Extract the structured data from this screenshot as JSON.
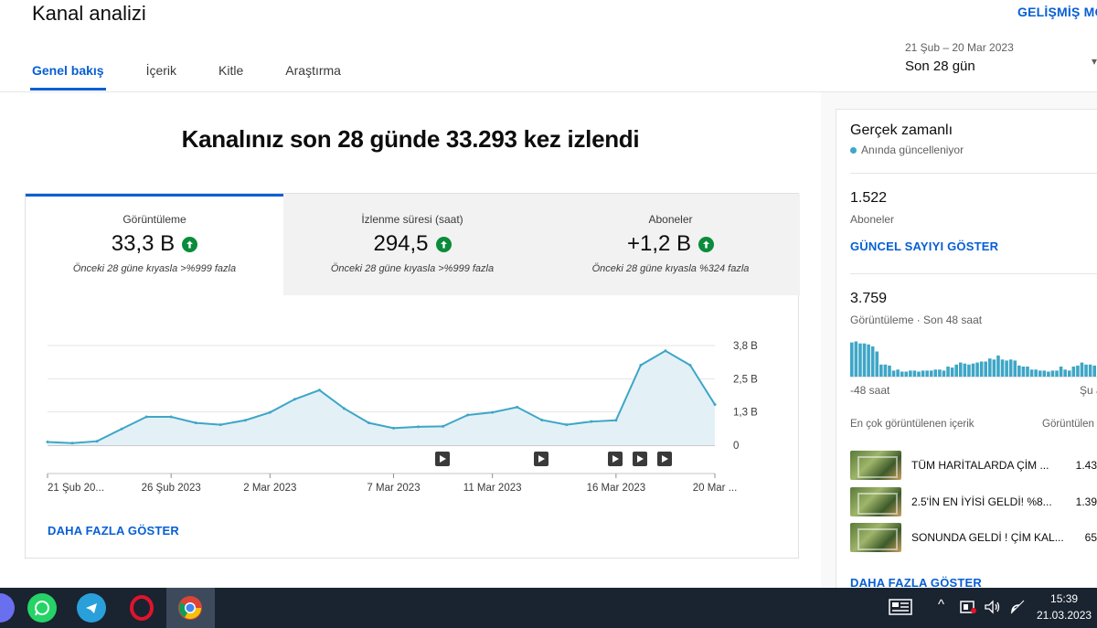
{
  "header": {
    "title": "Kanal analizi",
    "advanced_mode": "GELİŞMİŞ MO",
    "tabs": [
      {
        "label": "Genel bakış"
      },
      {
        "label": "İçerik"
      },
      {
        "label": "Kitle"
      },
      {
        "label": "Araştırma"
      }
    ],
    "active_tab": "Genel bakış",
    "date_range": "21 Şub – 20 Mar 2023",
    "date_period": "Son 28 gün"
  },
  "main": {
    "headline": "Kanalınız son 28 günde 33.293 kez izlendi",
    "metrics": [
      {
        "label": "Görüntüleme",
        "value": "33,3 B",
        "compare": "Önceki 28 güne kıyasla >%999 fazla"
      },
      {
        "label": "İzlenme süresi (saat)",
        "value": "294,5",
        "compare": "Önceki 28 güne kıyasla >%999 fazla"
      },
      {
        "label": "Aboneler",
        "value": "+1,2 B",
        "compare": "Önceki 28 güne kıyasla %324 fazla"
      }
    ],
    "more_label": "DAHA FAZLA GÖSTER"
  },
  "chart_data": {
    "type": "area",
    "title": "",
    "x": [
      "21 Şub",
      "22 Şub",
      "23 Şub",
      "24 Şub",
      "25 Şub",
      "26 Şub",
      "27 Şub",
      "28 Şub",
      "1 Mar",
      "2 Mar",
      "3 Mar",
      "4 Mar",
      "5 Mar",
      "6 Mar",
      "7 Mar",
      "8 Mar",
      "9 Mar",
      "10 Mar",
      "11 Mar",
      "12 Mar",
      "13 Mar",
      "14 Mar",
      "15 Mar",
      "16 Mar",
      "17 Mar",
      "18 Mar",
      "19 Mar",
      "20 Mar"
    ],
    "x_tick_labels": [
      "21 Şub 20...",
      "26 Şub 2023",
      "2 Mar 2023",
      "7 Mar 2023",
      "11 Mar 2023",
      "16 Mar 2023",
      "20 Mar ..."
    ],
    "y_tick_labels": [
      "3,8 B",
      "2,5 B",
      "1,3 B",
      "0"
    ],
    "ylim": [
      0,
      3800
    ],
    "grid": true,
    "series": [
      {
        "values": [
          120,
          80,
          150,
          620,
          1080,
          1080,
          850,
          780,
          950,
          1250,
          1750,
          2100,
          1400,
          850,
          650,
          700,
          720,
          1150,
          1250,
          1450,
          960,
          780,
          900,
          950,
          3050,
          3600,
          3050,
          1550
        ]
      }
    ],
    "event_markers": [
      "16 Mar",
      "16 Mar",
      "18 Mar",
      "19 Mar",
      "20 Mar"
    ]
  },
  "realtime": {
    "title": "Gerçek zamanlı",
    "live_label": "Anında güncelleniyor",
    "subscribers_value": "1.522",
    "subscribers_label": "Aboneler",
    "show_count_label": "GÜNCEL SAYIYI GÖSTER",
    "views_value": "3.759",
    "views_label": "Görüntüleme · Son 48 saat",
    "axis_left": "-48 saat",
    "axis_right": "Şu a",
    "top_content_header": "En çok görüntülenen içerik",
    "top_content_col": "Görüntülen",
    "top_content": [
      {
        "title": "TÜM HARİTALARDA ÇİM ...",
        "value": "1.43"
      },
      {
        "title": "2.5'İN EN İYİSİ GELDİ! %8...",
        "value": "1.39"
      },
      {
        "title": "SONUNDA GELDİ ! ÇİM KAL...",
        "value": "65"
      }
    ],
    "more_label": "DAHA FAZLA GÖSTER",
    "hourly_bars": [
      34,
      35,
      33,
      33,
      32,
      30,
      25,
      12,
      12,
      11,
      6,
      7,
      5,
      5,
      6,
      6,
      5,
      6,
      6,
      6,
      7,
      7,
      6,
      10,
      9,
      12,
      14,
      13,
      12,
      13,
      14,
      15,
      15,
      18,
      17,
      21,
      17,
      16,
      17,
      16,
      11,
      10,
      10,
      7,
      7,
      6,
      6,
      5,
      6,
      6,
      10,
      7,
      6,
      10,
      11,
      14,
      12,
      12,
      11
    ]
  },
  "taskbar": {
    "time": "15:39",
    "date": "21.03.2023"
  }
}
